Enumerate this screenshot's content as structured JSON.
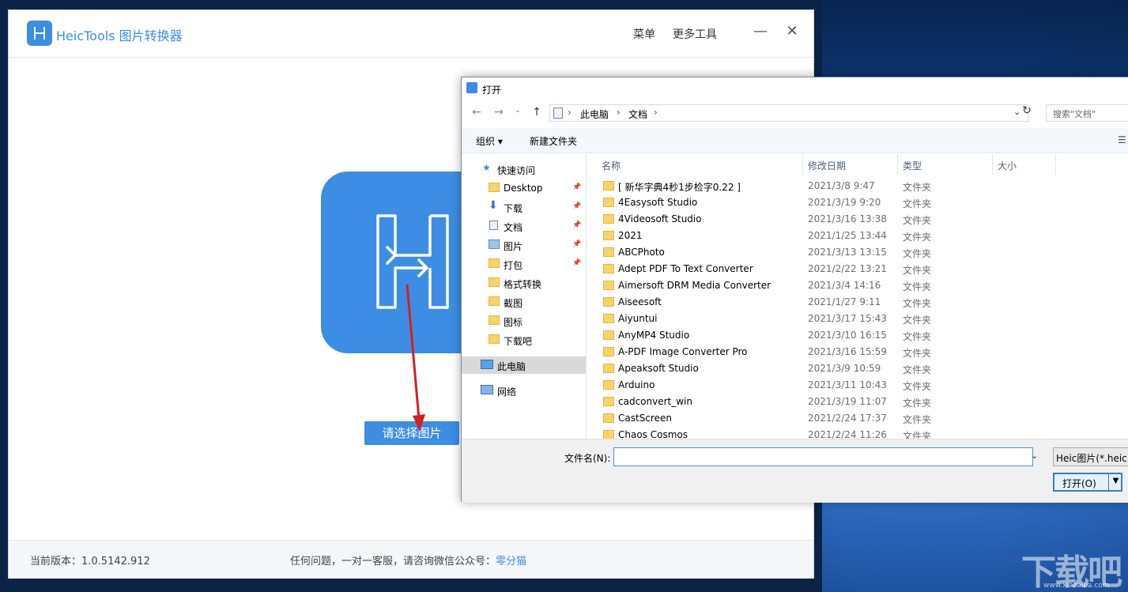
{
  "app": {
    "title": "HeicTools 图片转换器",
    "menu_label": "菜单",
    "more_tools_label": "更多工具",
    "minimize_glyph": "—",
    "close_glyph": "✕",
    "select_button_label": "请选择图片",
    "version_text": "当前版本：1.0.5142.912",
    "contact_text": "任何问题，一对一客服，请咨询微信公众号：",
    "contact_link": "零分猫",
    "accent_color": "#3d8de4"
  },
  "dialog": {
    "title": "打开",
    "breadcrumb": [
      "此电脑",
      "文档"
    ],
    "search_placeholder": "搜索\"文档\"",
    "toolbar": {
      "organize": "组织 ▾",
      "new_folder": "新建文件夹"
    },
    "nav_items": [
      {
        "label": "快速访问",
        "icon": "star-icon"
      },
      {
        "label": "Desktop",
        "icon": "folder-icon",
        "pinned": true
      },
      {
        "label": "下载",
        "icon": "download-icon",
        "pinned": true
      },
      {
        "label": "文档",
        "icon": "document-icon",
        "pinned": true
      },
      {
        "label": "图片",
        "icon": "picture-icon",
        "pinned": true
      },
      {
        "label": "打包",
        "icon": "folder-icon",
        "pinned": true
      },
      {
        "label": "格式转换",
        "icon": "folder-icon"
      },
      {
        "label": "截图",
        "icon": "folder-icon"
      },
      {
        "label": "图标",
        "icon": "folder-icon"
      },
      {
        "label": "下载吧",
        "icon": "folder-icon"
      },
      {
        "label": "此电脑",
        "icon": "computer-icon",
        "selected": true
      },
      {
        "label": "网络",
        "icon": "network-icon"
      }
    ],
    "columns": [
      "名称",
      "修改日期",
      "类型",
      "大小"
    ],
    "files": [
      {
        "name": "[ 新华字典4秒1步检字0.22 ]",
        "date": "2021/3/8 9:47",
        "type": "文件夹"
      },
      {
        "name": "4Easysoft Studio",
        "date": "2021/3/19 9:20",
        "type": "文件夹"
      },
      {
        "name": "4Videosoft Studio",
        "date": "2021/3/16 13:38",
        "type": "文件夹"
      },
      {
        "name": "2021",
        "date": "2021/1/25 13:44",
        "type": "文件夹"
      },
      {
        "name": "ABCPhoto",
        "date": "2021/3/13 13:15",
        "type": "文件夹"
      },
      {
        "name": "Adept PDF To Text Converter",
        "date": "2021/2/22 13:21",
        "type": "文件夹"
      },
      {
        "name": "Aimersoft DRM Media Converter",
        "date": "2021/3/4 14:16",
        "type": "文件夹"
      },
      {
        "name": "Aiseesoft",
        "date": "2021/1/27 9:11",
        "type": "文件夹"
      },
      {
        "name": "Aiyuntui",
        "date": "2021/3/17 15:43",
        "type": "文件夹"
      },
      {
        "name": "AnyMP4 Studio",
        "date": "2021/3/10 16:15",
        "type": "文件夹"
      },
      {
        "name": "A-PDF Image Converter Pro",
        "date": "2021/3/16 15:59",
        "type": "文件夹"
      },
      {
        "name": "Apeaksoft Studio",
        "date": "2021/3/9 10:59",
        "type": "文件夹"
      },
      {
        "name": "Arduino",
        "date": "2021/3/11 10:43",
        "type": "文件夹"
      },
      {
        "name": "cadconvert_win",
        "date": "2021/3/19 11:07",
        "type": "文件夹"
      },
      {
        "name": "CastScreen",
        "date": "2021/2/24 17:37",
        "type": "文件夹"
      },
      {
        "name": "Chaos Cosmos",
        "date": "2021/2/24 11:26",
        "type": "文件夹"
      }
    ],
    "filename_label": "文件名(N):",
    "filename_value": "",
    "filter_value": "Heic图片(*.heic)",
    "open_button": "打开(O)"
  },
  "watermark": {
    "text": "下载吧",
    "url": "www.xiazaiba.com"
  }
}
